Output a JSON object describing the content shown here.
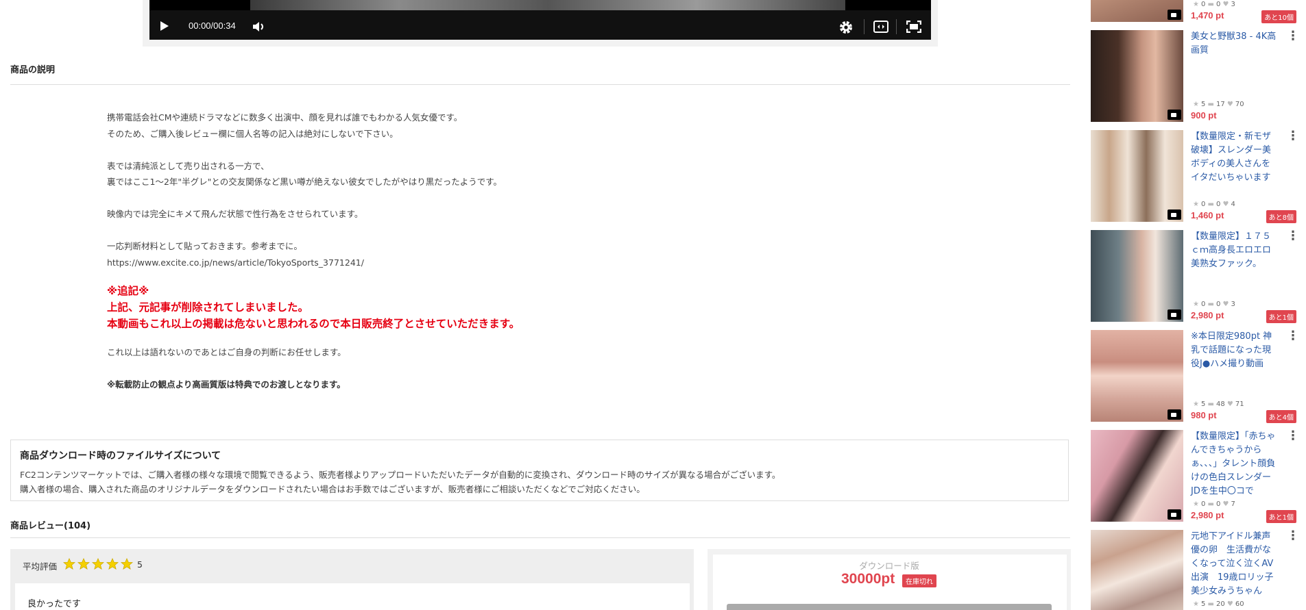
{
  "player": {
    "time": "00:00/00:34"
  },
  "description": {
    "heading": "商品の説明",
    "lines": [
      "携帯電話会社CMや連続ドラマなどに数多く出演中、顔を見れば誰でもわかる人気女優です。",
      "そのため、ご購入後レビュー欄に個人名等の記入は絶対にしないで下さい。",
      "表では清純派として売り出される一方で、",
      "裏ではここ1～2年\"半グレ\"との交友関係など黒い噂が絶えない彼女でしたがやはり黒だったようです。",
      "映像内では完全にキメて飛んだ状態で性行為をさせられています。",
      "一応判断材料として貼っておきます。参考までに。",
      "https://www.excite.co.jp/news/article/TokyoSports_3771241/",
      "※追記※",
      "上記、元記事が削除されてしまいました。",
      "本動画もこれ以上の掲載は危ないと思われるので本日販売終了とさせていただきます。",
      "これ以上は語れないのであとはご自身の判断にお任せします。",
      "※転載防止の観点より高画質版は特典でのお渡しとなります。"
    ]
  },
  "notice": {
    "title": "商品ダウンロード時のファイルサイズについて",
    "line1": "FC2コンテンツマーケットでは、ご購入者様の様々な環境で閲覧できるよう、販売者様よりアップロードいただいたデータが自動的に変換され、ダウンロード時のサイズが異なる場合がございます。",
    "line2": "購入者様の場合、購入された商品のオリジナルデータをダウンロードされたい場合はお手数ではございますが、販売者様にご相談いただくなどでご対応ください。"
  },
  "reviews": {
    "heading": "商品レビュー(104)",
    "avg_label": "平均評価",
    "avg_value": "5",
    "rating": 5,
    "first_review_title": "良かったです"
  },
  "purchase": {
    "label": "ダウンロード版",
    "price": "30000pt",
    "badge": "在庫切れ"
  },
  "sidebar": {
    "items": [
      {
        "title": "",
        "stats": {
          "stars": "0",
          "comments": "0",
          "likes": "3"
        },
        "price": "1,470 pt",
        "badge": "あと10個",
        "thumb_color": "#c79a82"
      },
      {
        "title": "美女と野獣38 - 4K高画質",
        "stats": {
          "stars": "5",
          "comments": "17",
          "likes": "70"
        },
        "price": "900 pt",
        "badge": "",
        "thumb_color": "#9c7460"
      },
      {
        "title": "【数量限定・新モザ破壊】スレンダー美ボディの美人さんをイタだいちゃいます",
        "stats": {
          "stars": "0",
          "comments": "0",
          "likes": "4"
        },
        "price": "1,460 pt",
        "badge": "あと8個",
        "thumb_color": "#b8a58f"
      },
      {
        "title": "【数量限定】１７５ｃｍ高身長エロエロ美熟女ファック。",
        "stats": {
          "stars": "0",
          "comments": "0",
          "likes": "3"
        },
        "price": "2,980 pt",
        "badge": "あと1個",
        "thumb_color": "#6e7f86"
      },
      {
        "title": "※本日限定980pt 神乳で話題になった現役J●ハメ撮り動画",
        "stats": {
          "stars": "5",
          "comments": "48",
          "likes": "71"
        },
        "price": "980 pt",
        "badge": "あと4個",
        "thumb_color": "#d4a69a"
      },
      {
        "title": "【数量限定】「赤ちゃんできちゃうからぁ、、、」タレント顔負けの色白スレンダーJDを生中〇コで",
        "stats": {
          "stars": "0",
          "comments": "0",
          "likes": "7"
        },
        "price": "2,980 pt",
        "badge": "あと1個",
        "thumb_color": "#d7a7ad"
      },
      {
        "title": "元地下アイドル兼声優の卵　生活費がなくなって泣く泣くAV出演　19歳ロリッ子美少女みうちゃん",
        "stats": {
          "stars": "5",
          "comments": "20",
          "likes": "60"
        },
        "price": "",
        "badge": "",
        "thumb_color": "#c9b0a6"
      }
    ]
  }
}
